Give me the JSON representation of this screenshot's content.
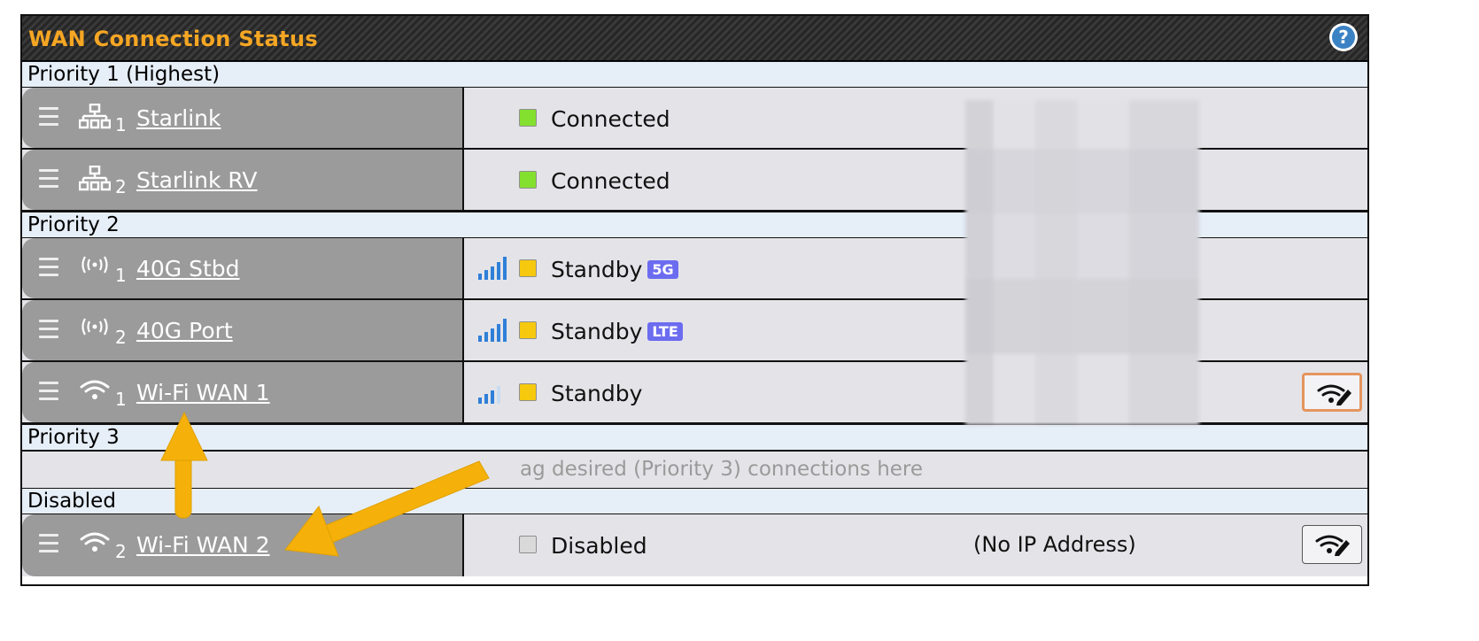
{
  "panel": {
    "title": "WAN Connection Status"
  },
  "colors": {
    "title": "#f5a623",
    "connected": "#84e02e",
    "standby": "#f6c90e",
    "disabled": "#d9d9d9",
    "badge": "#6c6cf0",
    "arrow": "#f5b10a"
  },
  "sections": {
    "p1": "Priority 1 (Highest)",
    "p2": "Priority 2",
    "p3": "Priority 3",
    "disabled": "Disabled"
  },
  "connections": [
    {
      "index": "1",
      "name": "Starlink",
      "icon": "ethernet-icon",
      "status": "Connected"
    },
    {
      "index": "2",
      "name": "Starlink RV",
      "icon": "ethernet-icon",
      "status": "Connected"
    },
    {
      "index": "1",
      "name": "40G Stbd",
      "icon": "cellular-icon",
      "status": "Standby",
      "badge": "5G",
      "signal_bars": 5
    },
    {
      "index": "2",
      "name": "40G Port",
      "icon": "cellular-icon",
      "status": "Standby",
      "badge": "LTE",
      "signal_bars": 5
    },
    {
      "index": "1",
      "name": "Wi-Fi WAN 1",
      "icon": "wifi-icon",
      "status": "Standby",
      "signal_bars": 3
    },
    {
      "index": "2",
      "name": "Wi-Fi WAN 2",
      "icon": "wifi-icon",
      "status": "Disabled",
      "ip": "(No IP Address)"
    }
  ],
  "priority3_placeholder": "ag desired (Priority 3) connections here"
}
